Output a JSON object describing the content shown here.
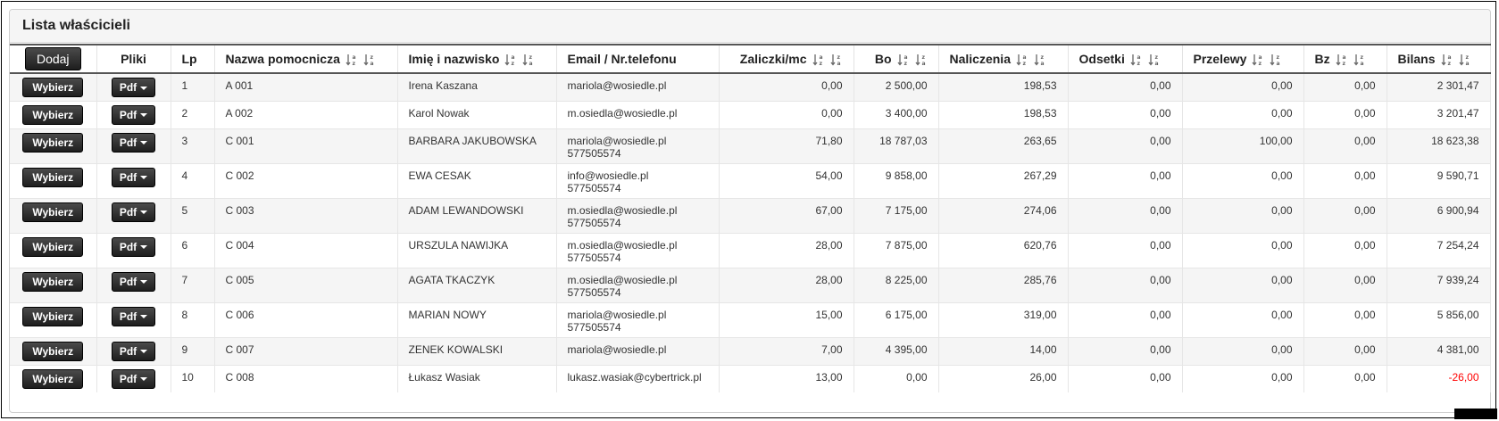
{
  "panel": {
    "title": "Lista właścicieli"
  },
  "buttons": {
    "add": "Dodaj",
    "select": "Wybierz",
    "pdf": "Pdf"
  },
  "columns": {
    "files": "Pliki",
    "lp": "Lp",
    "aux_name": "Nazwa pomocnicza",
    "full_name": "Imię i nazwisko",
    "email_phone": "Email / Nr.telefonu",
    "advance": "Zaliczki/mc",
    "bo": "Bo",
    "charges": "Naliczenia",
    "interest": "Odsetki",
    "transfers": "Przelewy",
    "bz": "Bz",
    "balance": "Bilans"
  },
  "colors": {
    "negative": "#ff0000",
    "button_dark": "#1e1e1e"
  },
  "rows": [
    {
      "lp": "1",
      "aux": "A 001",
      "name": "Irena Kaszana",
      "email": "mariola@wosiedle.pl",
      "phone": "",
      "advance": "0,00",
      "bo": "2 500,00",
      "charges": "198,53",
      "interest": "0,00",
      "transfers": "0,00",
      "bz": "0,00",
      "balance": "2 301,47"
    },
    {
      "lp": "2",
      "aux": "A 002",
      "name": "Karol Nowak",
      "email": "m.osiedla@wosiedle.pl",
      "phone": "",
      "advance": "0,00",
      "bo": "3 400,00",
      "charges": "198,53",
      "interest": "0,00",
      "transfers": "0,00",
      "bz": "0,00",
      "balance": "3 201,47"
    },
    {
      "lp": "3",
      "aux": "C 001",
      "name": "BARBARA JAKUBOWSKA",
      "email": "mariola@wosiedle.pl",
      "phone": "577505574",
      "advance": "71,80",
      "bo": "18 787,03",
      "charges": "263,65",
      "interest": "0,00",
      "transfers": "100,00",
      "bz": "0,00",
      "balance": "18 623,38"
    },
    {
      "lp": "4",
      "aux": "C 002",
      "name": "EWA CESAK",
      "email": "info@wosiedle.pl",
      "phone": "577505574",
      "advance": "54,00",
      "bo": "9 858,00",
      "charges": "267,29",
      "interest": "0,00",
      "transfers": "0,00",
      "bz": "0,00",
      "balance": "9 590,71"
    },
    {
      "lp": "5",
      "aux": "C 003",
      "name": "ADAM LEWANDOWSKI",
      "email": "m.osiedla@wosiedle.pl",
      "phone": "577505574",
      "advance": "67,00",
      "bo": "7 175,00",
      "charges": "274,06",
      "interest": "0,00",
      "transfers": "0,00",
      "bz": "0,00",
      "balance": "6 900,94"
    },
    {
      "lp": "6",
      "aux": "C 004",
      "name": "URSZULA NAWIJKA",
      "email": "m.osiedla@wosiedle.pl",
      "phone": "577505574",
      "advance": "28,00",
      "bo": "7 875,00",
      "charges": "620,76",
      "interest": "0,00",
      "transfers": "0,00",
      "bz": "0,00",
      "balance": "7 254,24"
    },
    {
      "lp": "7",
      "aux": "C 005",
      "name": "AGATA TKACZYK",
      "email": "m.osiedla@wosiedle.pl",
      "phone": "577505574",
      "advance": "28,00",
      "bo": "8 225,00",
      "charges": "285,76",
      "interest": "0,00",
      "transfers": "0,00",
      "bz": "0,00",
      "balance": "7 939,24"
    },
    {
      "lp": "8",
      "aux": "C 006",
      "name": "MARIAN NOWY",
      "email": "mariola@wosiedle.pl",
      "phone": "577505574",
      "advance": "15,00",
      "bo": "6 175,00",
      "charges": "319,00",
      "interest": "0,00",
      "transfers": "0,00",
      "bz": "0,00",
      "balance": "5 856,00"
    },
    {
      "lp": "9",
      "aux": "C 007",
      "name": "ZENEK KOWALSKI",
      "email": "mariola@wosiedle.pl",
      "phone": "",
      "advance": "7,00",
      "bo": "4 395,00",
      "charges": "14,00",
      "interest": "0,00",
      "transfers": "0,00",
      "bz": "0,00",
      "balance": "4 381,00"
    },
    {
      "lp": "10",
      "aux": "C 008",
      "name": "Łukasz Wasiak",
      "email": "lukasz.wasiak@cybertrick.pl",
      "phone": "",
      "advance": "13,00",
      "bo": "0,00",
      "charges": "26,00",
      "interest": "0,00",
      "transfers": "0,00",
      "bz": "0,00",
      "balance": "-26,00"
    }
  ]
}
